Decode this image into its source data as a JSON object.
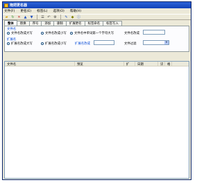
{
  "window": {
    "title": "拖把更名器"
  },
  "menu": [
    "文件(F)",
    "更名(E)",
    "标签(L)",
    "选项(O)",
    "帮助(H)"
  ],
  "tabs": [
    "整体",
    "替换",
    "序号",
    "添加",
    "删除",
    "扩展更名",
    "标签命名",
    "标签写入"
  ],
  "filename_group": {
    "label": "文件名",
    "options": [
      "文件名改成大写",
      "文件名改成小写",
      "文件名中单词第一个字母大写"
    ],
    "field_label": "文件名改成",
    "field_value": ""
  },
  "extension_group": {
    "label": "扩展名",
    "options": [
      "扩展名改成大写",
      "扩展名改成小写"
    ],
    "field_label": "扩展名改成",
    "field_value": ""
  },
  "file_filter": {
    "label": "文件过滤",
    "value": ""
  },
  "list_columns": [
    "文件名",
    "预览",
    "扩",
    "日期",
    "识",
    "格"
  ]
}
